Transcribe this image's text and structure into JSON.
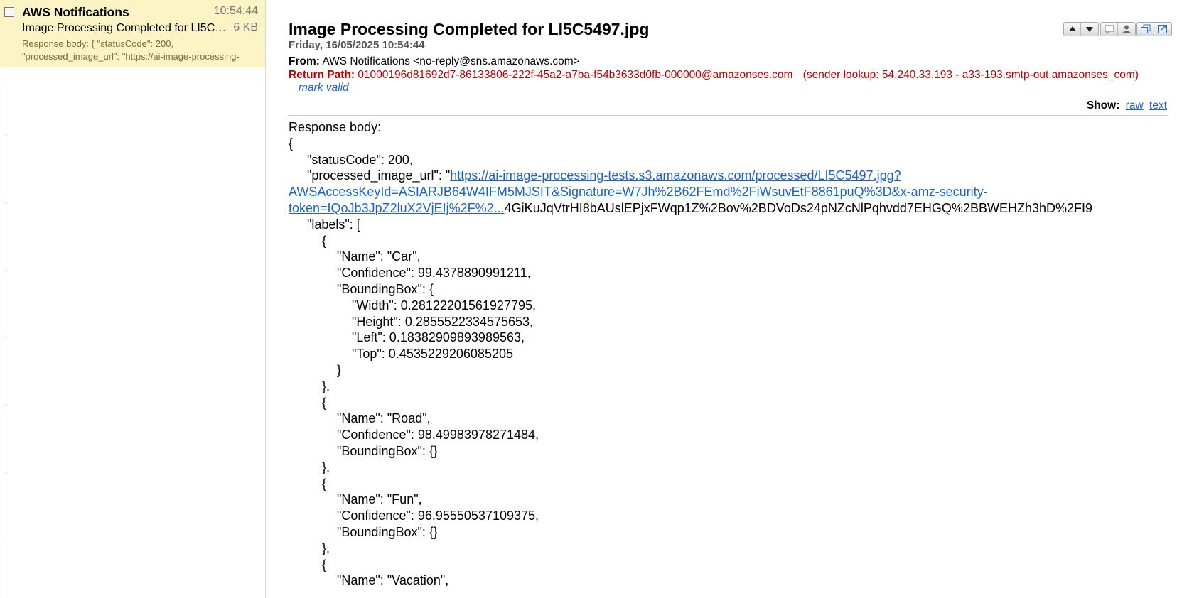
{
  "message_list": {
    "selected_item": {
      "sender": "AWS Notifications",
      "time": "10:54:44",
      "subject": "Image Processing Completed for LI5C5497.jpg",
      "size": "6 KB",
      "preview": "Response body: { \"statusCode\": 200, \"processed_image_url\": \"https://ai-image-processing-"
    }
  },
  "message": {
    "subject": "Image Processing Completed for LI5C5497.jpg",
    "date": "Friday, 16/05/2025 10:54:44",
    "from_label": "From:",
    "from_value": "AWS Notifications <no-reply@sns.amazonaws.com>",
    "return_path_label": "Return Path:",
    "return_path_value": "01000196d81692d7-86133806-222f-45a2-a7ba-f54b3633d0fb-000000@amazonses.com",
    "sender_lookup": "(sender lookup: 54.240.33.193 - a33-193.smtp-out.amazonses_com)",
    "mark_valid": "mark valid",
    "show_label": "Show:",
    "show_raw": "raw",
    "show_text": "text"
  },
  "toolbar": {
    "icons": [
      "arrow-up-icon",
      "arrow-down-icon",
      "speech-bubble-icon",
      "person-icon",
      "copy-window-icon",
      "open-window-icon"
    ]
  },
  "body": {
    "lines": [
      "Response body:",
      "{",
      "\"statusCode\": 200,",
      "\"processed_image_url\": \"",
      "\"labels\": [",
      "{",
      "\"Name\": \"Car\",",
      "\"Confidence\": 99.4378890991211,",
      "\"BoundingBox\": {",
      "\"Width\": 0.28122201561927795,",
      "\"Height\": 0.2855522334575653,",
      "\"Left\": 0.18382909893989563,",
      "\"Top\": 0.4535229206085205",
      "}",
      "},",
      "{",
      "\"Name\": \"Road\",",
      "\"Confidence\": 98.49983978271484,",
      "\"BoundingBox\": {}",
      "},",
      "{",
      "\"Name\": \"Fun\",",
      "\"Confidence\": 96.95550537109375,",
      "\"BoundingBox\": {}",
      "},",
      "{",
      "\"Name\": \"Vacation\","
    ],
    "url_line1": "https://ai-image-processing-tests.s3.amazonaws.com/processed/LI5C5497.jpg?",
    "url_line2": "AWSAccessKeyId=ASIARJB64W4IFM5MJSIT&Signature=W7Jh%2B62FEmd%2FiWsuvEtF8861puQ%3D&x-amz-security-",
    "url_line3": "token=IQoJb3JpZ2luX2VjEIj%2F%2...",
    "url_tail": "4GiKuJqVtrHI8bAUslEPjxFWqp1Z%2Bov%2BDVoDs24pNZcNlPqhvdd7EHGQ%2BBWEHZh3hD%2FI9"
  },
  "colors": {
    "selected_bg": "#fcf4c4",
    "link": "#1a64c8",
    "return_path": "#c00000"
  }
}
